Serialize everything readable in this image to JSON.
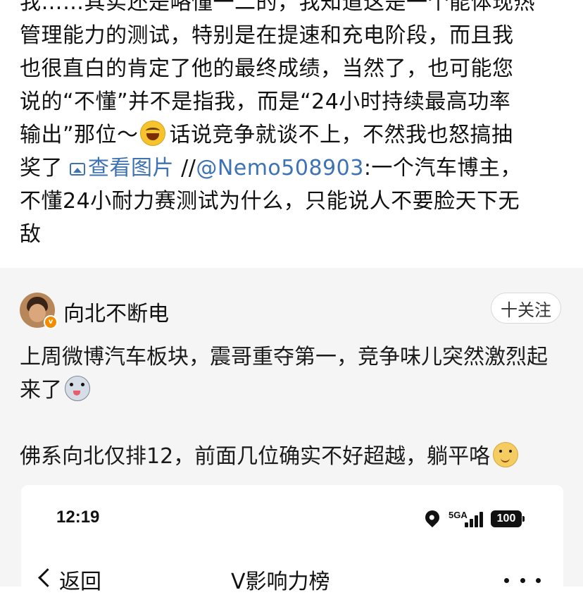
{
  "post": {
    "lines": [
      "我……其实还是略懂一二的，我知道这是一个能体现热",
      "管理能力的测试，特别是在提速和充电阶段，而且我",
      "也很直白的肯定了他的最终成绩，当然了，也可能您",
      "说的“不懂”并不是指我，而是“24小时持续最高功率",
      "输出”那位～",
      "话说竞争就谈不上，不然我也怒搞抽",
      "奖了",
      "查看图片",
      "//",
      "@Nemo508903",
      ":一个汽车博主，",
      "不懂24小耐力赛测试为什么，只能说人不要脸天下无",
      "敌"
    ]
  },
  "comment": {
    "username": "向北不断电",
    "follow_label": "十关注",
    "text_line1": "上周微博汽车板块，震哥重夺第一，竞争味儿突然激烈起",
    "text_line2": "来了",
    "text_line3": "佛系向北仅排12，前面几位确实不好超越，躺平咯",
    "emoji_1": "laughing-tears-emoji",
    "emoji_2": "husky-emoji",
    "emoji_3": "doge-emoji"
  },
  "embedded_screenshot": {
    "time": "12:19",
    "network": "5GA",
    "battery": "100",
    "back_label": "返回",
    "title": "V影响力榜"
  },
  "colors": {
    "link": "#3d72b4",
    "card_background": "#f5f5f5",
    "verified_badge": "#f28d00"
  }
}
